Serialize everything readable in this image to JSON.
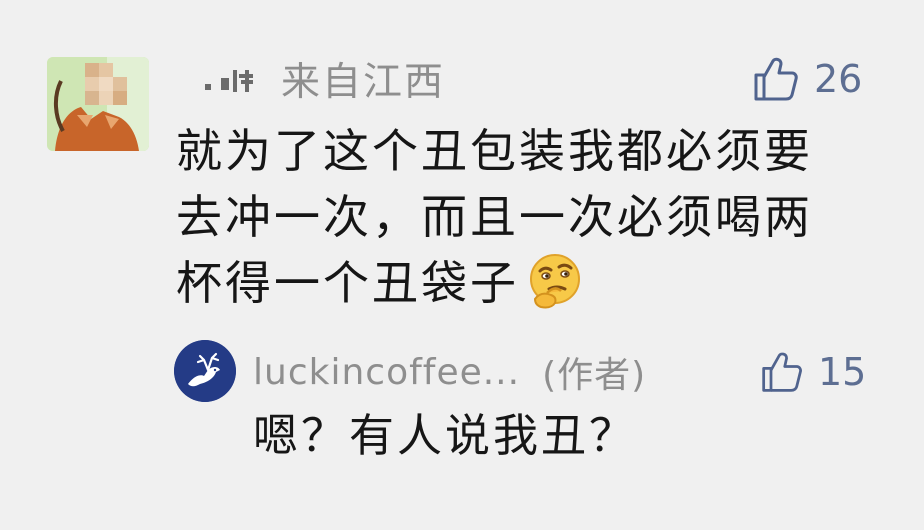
{
  "comment": {
    "location": "来自江西",
    "like_count": "26",
    "text_lines": [
      "就为了这个丑包装我都必须要",
      "去冲一次，而且一次必须喝两",
      "杯得一个丑袋子"
    ],
    "emoji": "thinking-emoji",
    "like_icon": "thumbs-up-icon"
  },
  "reply": {
    "username": "luckincoffee...",
    "author_tag": "(作者)",
    "like_count": "15",
    "text": "嗯？有人说我丑？",
    "like_icon": "thumbs-up-icon"
  },
  "colors": {
    "background": "#f0f0f0",
    "text": "#161616",
    "meta": "#8e8e8e",
    "like": "#5d6e92",
    "brand_avatar": "#243b86"
  }
}
